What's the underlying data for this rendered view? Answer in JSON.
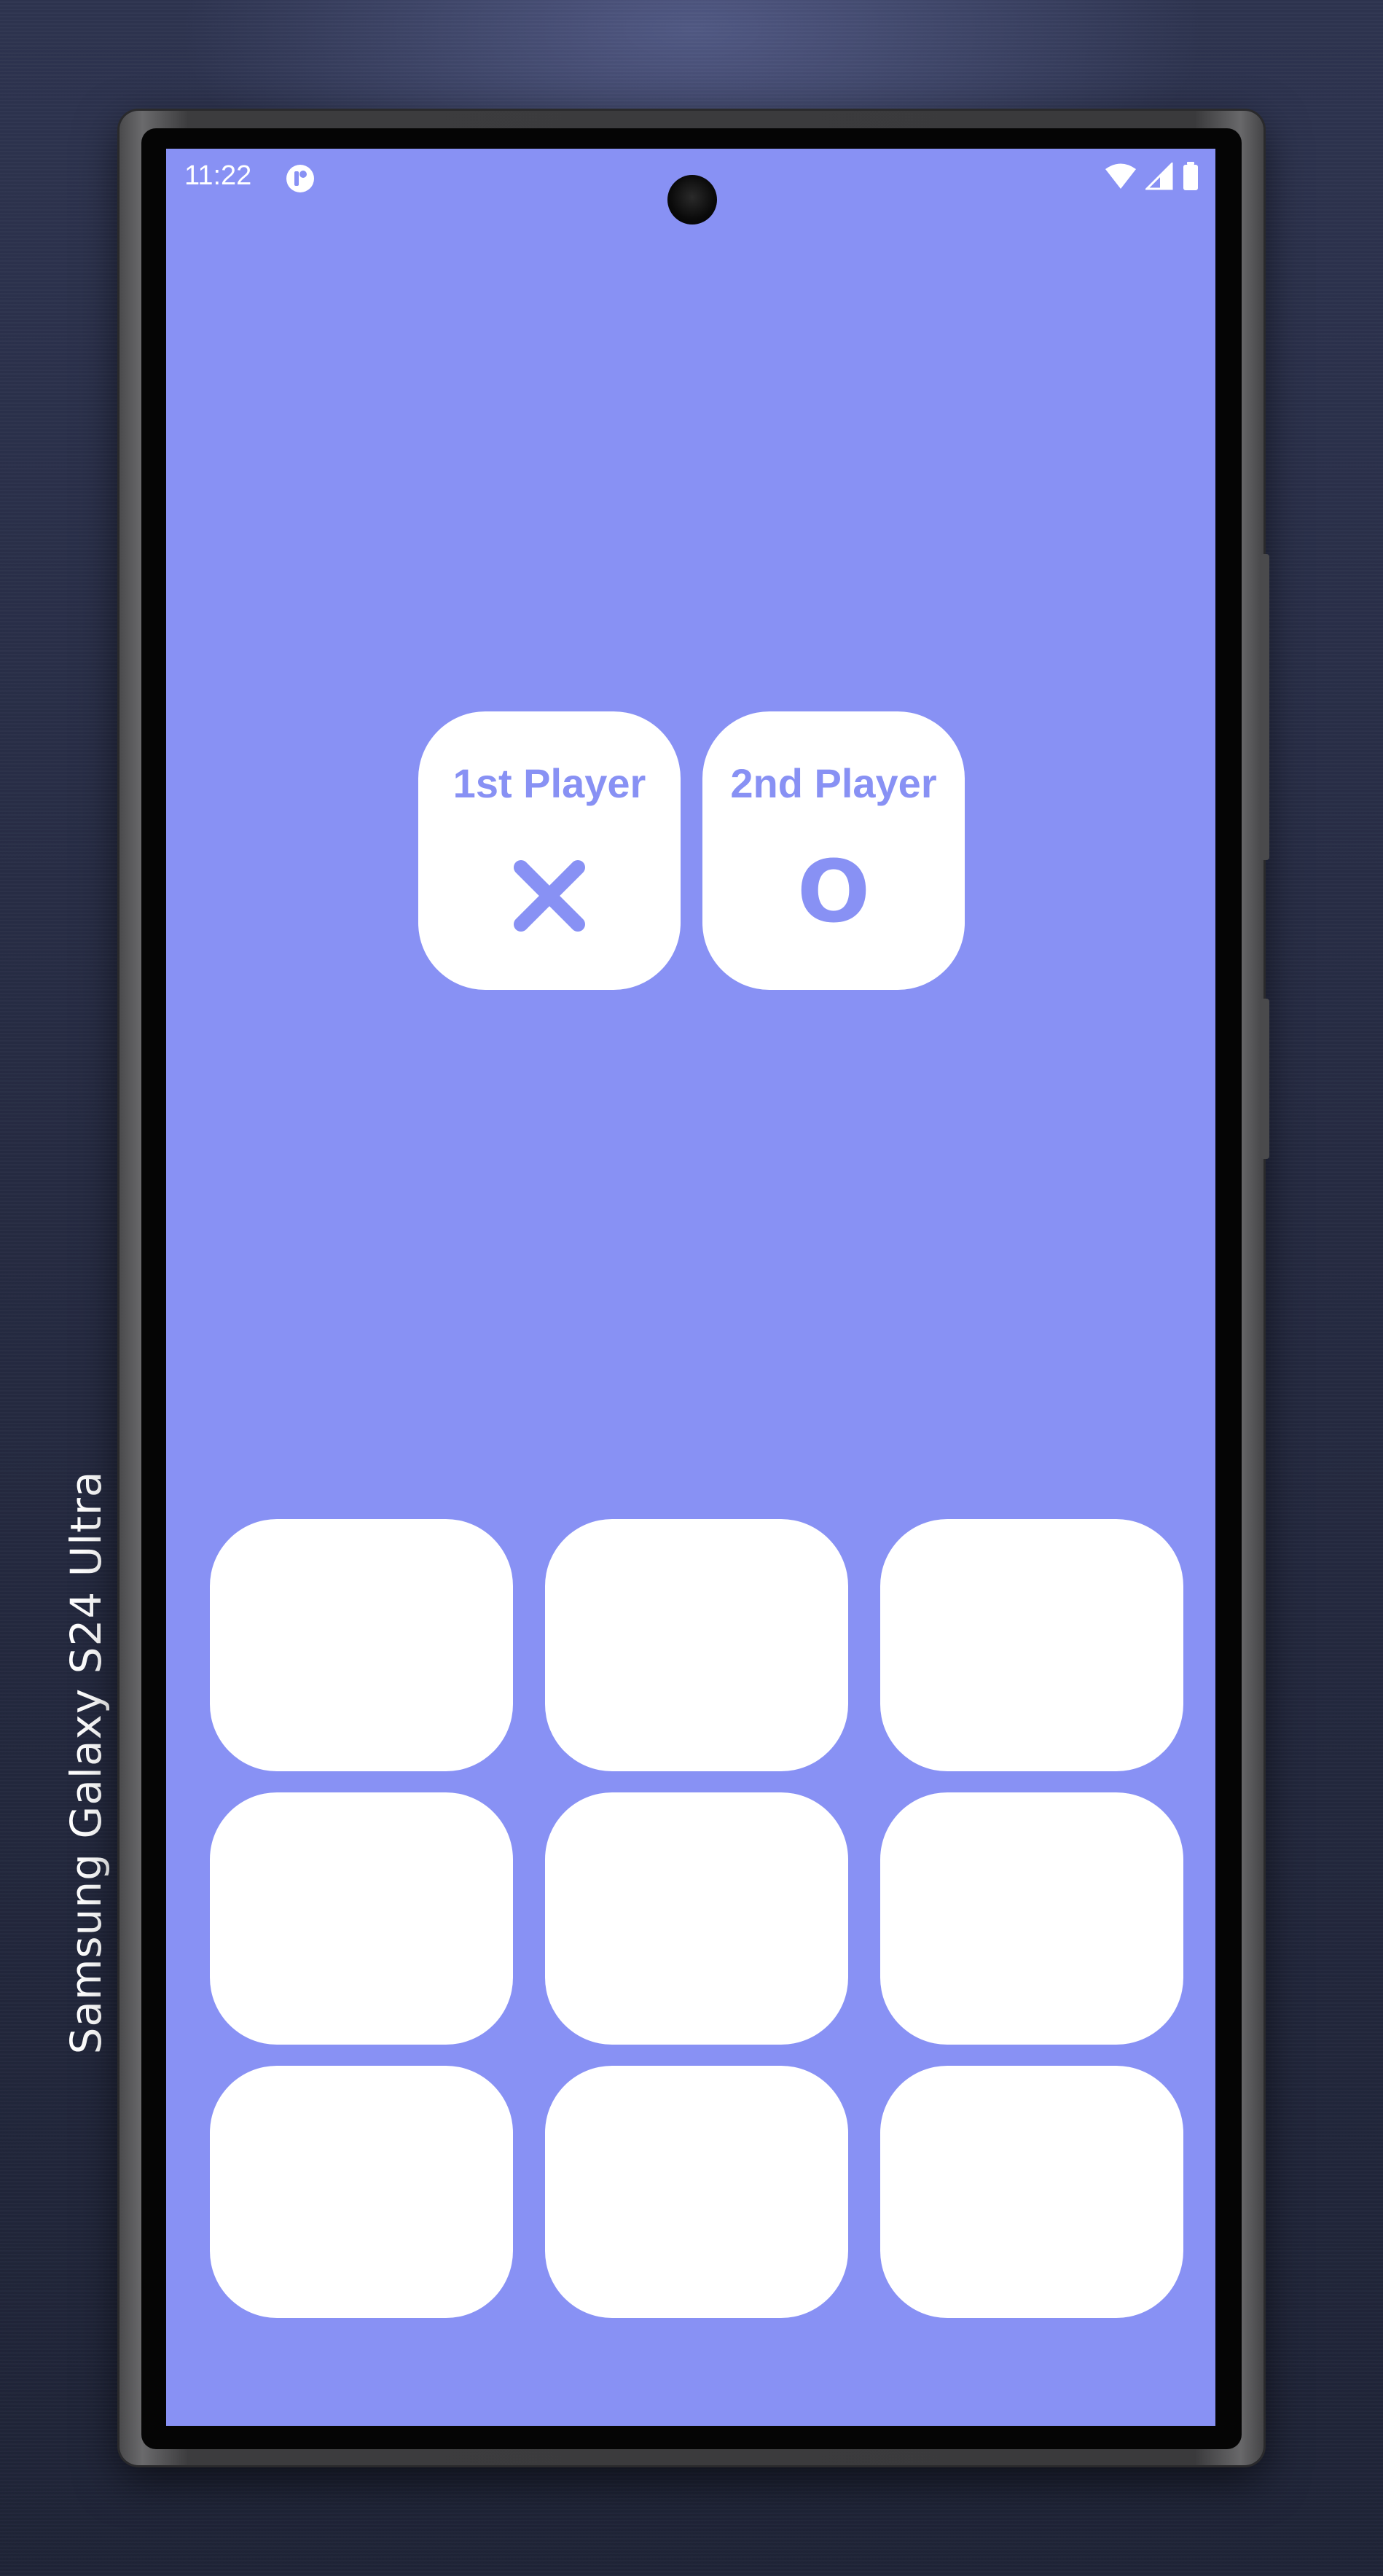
{
  "device": {
    "label": "Samsung Galaxy  S24 Ultra"
  },
  "status_bar": {
    "time": "11:22",
    "icons": [
      "app-notification-icon",
      "wifi-icon",
      "signal-icon",
      "battery-icon"
    ]
  },
  "players": [
    {
      "label": "1st Player",
      "mark": "x-mark"
    },
    {
      "label": "2nd Player",
      "mark": "O"
    }
  ],
  "board": {
    "rows": 3,
    "columns": 3,
    "cells": [
      "",
      "",
      "",
      "",
      "",
      "",
      "",
      "",
      ""
    ]
  },
  "colors": {
    "background": "#8891f4",
    "card": "#ffffff",
    "accent": "#8891f4"
  }
}
